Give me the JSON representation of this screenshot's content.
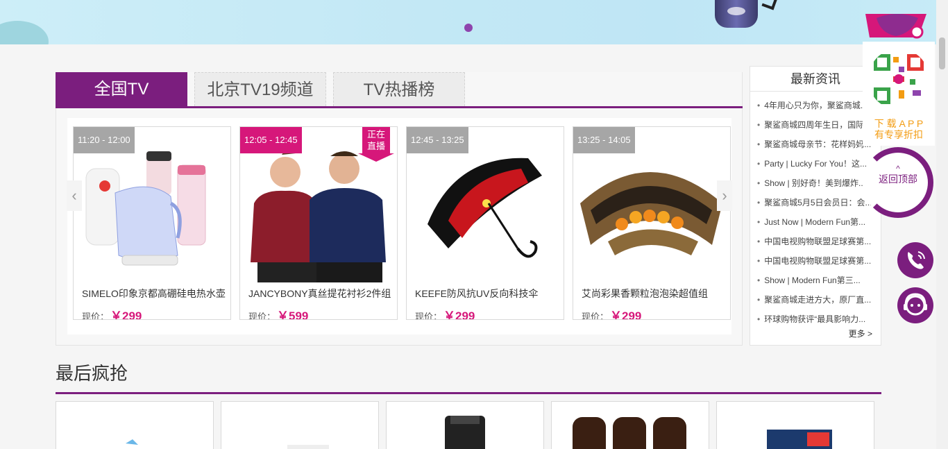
{
  "banner": {
    "active_dot": 1
  },
  "tabs": [
    {
      "label": "全国TV",
      "active": true
    },
    {
      "label": "北京TV19频道",
      "active": false
    },
    {
      "label": "TV热播榜",
      "active": false
    }
  ],
  "products": [
    {
      "time": "11:20 - 12:00",
      "name": "SIMELO印象京都高硼硅电热水壶",
      "price_label": "现价：",
      "price": "￥299",
      "live": false,
      "icon": "kettle-image"
    },
    {
      "time": "12:05 - 12:45",
      "name": "JANCYBONY真丝提花衬衫2件组",
      "price_label": "现价：",
      "price": "￥599",
      "live": true,
      "live_text_1": "正在",
      "live_text_2": "直播",
      "icon": "shirts-image"
    },
    {
      "time": "12:45 - 13:25",
      "name": "KEEFE防风抗UV反向科技伞",
      "price_label": "现价：",
      "price": "￥299",
      "live": false,
      "icon": "umbrella-image"
    },
    {
      "time": "13:25 - 14:05",
      "name": "艾尚彩果香颗粒泡泡染超值组",
      "price_label": "现价：",
      "price": "￥299",
      "live": false,
      "icon": "hair-dye-image"
    }
  ],
  "news": {
    "title": "最新资讯",
    "items": [
      "4年用心只为你，聚鲨商城...",
      "聚鲨商城四周年生日，国际...",
      "聚鲨商城母亲节：花样妈妈...",
      "Party | Lucky For You！这...",
      "Show | 别好奇！美到爆炸...",
      "聚鲨商城5月5日会员日：会...",
      "Just Now | Modern Fun第...",
      "中国电视购物联盟足球赛第...",
      "中国电视购物联盟足球赛第...",
      "Show | Modern Fun第三...",
      "聚鲨商城走进方大，原厂直...",
      "环球购物获评“最具影响力..."
    ],
    "more": "更多 >"
  },
  "last_section": {
    "title": "最后疯抢"
  },
  "sidebar": {
    "download_line1": "下 载 A P P",
    "download_line2": "有专享折扣",
    "back_top": "返回顶部",
    "back_top_chevron": "^"
  },
  "colors": {
    "brand": "#7b1e7e",
    "accent": "#d6177a",
    "price": "#d6177a"
  }
}
